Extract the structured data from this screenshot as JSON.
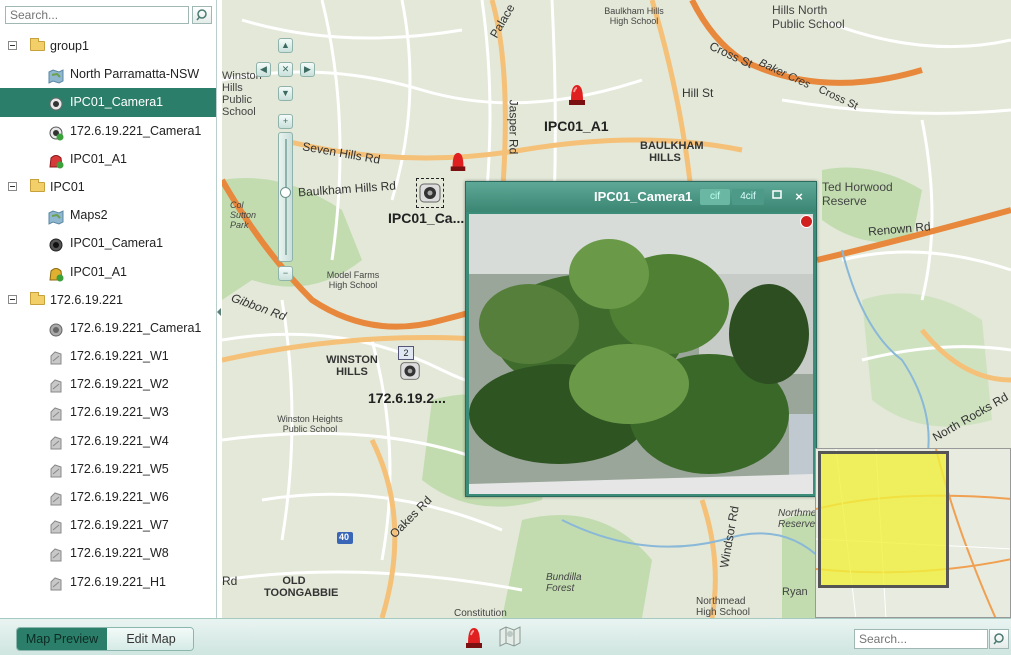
{
  "tree_search": {
    "placeholder": "Search..."
  },
  "tree": [
    {
      "label": "group1",
      "type": "group",
      "indent": 0
    },
    {
      "label": "North Parramatta-NSW",
      "type": "map",
      "indent": 1
    },
    {
      "label": "IPC01_Camera1",
      "type": "camera",
      "indent": 1,
      "selected": true
    },
    {
      "label": "172.6.19.221_Camera1",
      "type": "camera-green",
      "indent": 1
    },
    {
      "label": "IPC01_A1",
      "type": "alarm-red",
      "indent": 1
    },
    {
      "label": "IPC01",
      "type": "group",
      "indent": 0
    },
    {
      "label": "Maps2",
      "type": "map",
      "indent": 1
    },
    {
      "label": "IPC01_Camera1",
      "type": "camera-dark",
      "indent": 1
    },
    {
      "label": "IPC01_A1",
      "type": "alarm-yellow",
      "indent": 1
    },
    {
      "label": "172.6.19.221",
      "type": "group",
      "indent": 0
    },
    {
      "label": "172.6.19.221_Camera1",
      "type": "camera-gray",
      "indent": 1
    },
    {
      "label": "172.6.19.221_W1",
      "type": "zone",
      "indent": 1
    },
    {
      "label": "172.6.19.221_W2",
      "type": "zone",
      "indent": 1
    },
    {
      "label": "172.6.19.221_W3",
      "type": "zone",
      "indent": 1
    },
    {
      "label": "172.6.19.221_W4",
      "type": "zone",
      "indent": 1
    },
    {
      "label": "172.6.19.221_W5",
      "type": "zone",
      "indent": 1
    },
    {
      "label": "172.6.19.221_W6",
      "type": "zone",
      "indent": 1
    },
    {
      "label": "172.6.19.221_W7",
      "type": "zone",
      "indent": 1
    },
    {
      "label": "172.6.19.221_W8",
      "type": "zone",
      "indent": 1
    },
    {
      "label": "172.6.19.221_H1",
      "type": "zone",
      "indent": 1
    }
  ],
  "map": {
    "place_labels": [
      "Baulkham Hills High School",
      "Hills North Public School",
      "Ted Horwood Reserve",
      "BAULKHAM HILLS",
      "Model Farms High School",
      "WINSTON HILLS",
      "Winston Heights Public School",
      "OLD TOONGABBIE",
      "Bundilla Forest",
      "Northmead High School",
      "Constitution",
      "Col Sutton Park",
      "Winston Hills Public School",
      "Northmead Reserve",
      "Ryan"
    ],
    "streets": [
      "Cross St",
      "Baker Cres",
      "Cross St",
      "Hill St",
      "Jasper Rd",
      "Seven Hills Rd",
      "Baulkham Hills Rd",
      "Gibbon Rd",
      "Renown Rd",
      "North Rocks Rd",
      "Oakes Rd",
      "Windsor Rd",
      "Palace",
      "Rd"
    ],
    "route_number": "40",
    "zone_badge": "2",
    "devices": [
      {
        "label": "IPC01_A1",
        "icon": "alarm-siren"
      },
      {
        "label": "IPC01_Ca...",
        "icon": "camera"
      },
      {
        "label": "172.6.19.2...",
        "icon": "camera"
      }
    ]
  },
  "popup": {
    "title": "IPC01_Camera1",
    "btn_cif": "cif",
    "btn_4cif": "4cif",
    "maximize_icon": "maximize-icon",
    "close_icon": "×"
  },
  "bottom": {
    "tab_preview": "Map Preview",
    "tab_edit": "Edit Map",
    "search_placeholder": "Search..."
  },
  "colors": {
    "accent": "#2b7f6a",
    "map_road": "#f0a050",
    "map_highway": "#e8883c",
    "map_park": "#b8d8a8",
    "alarm": "#e02020"
  }
}
